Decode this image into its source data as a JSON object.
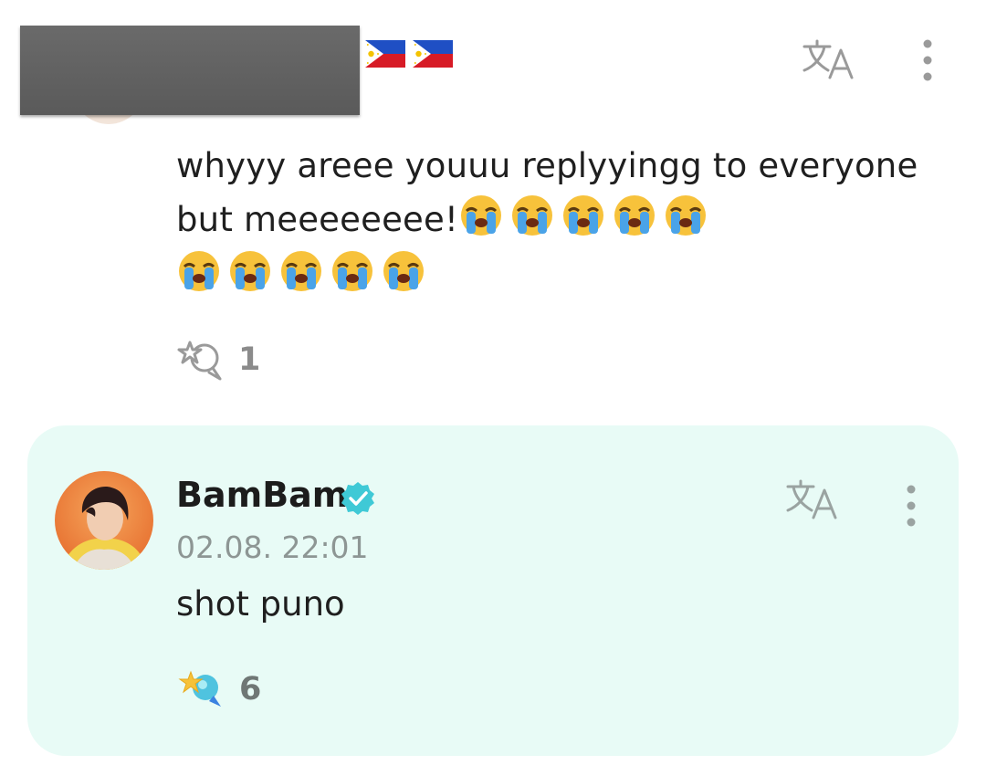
{
  "colors": {
    "reply_card_background": "#e8fbf6",
    "verified_badge": "#3fc9d6",
    "muted_text": "#8d9694",
    "icon_gray": "#9a9a9a"
  },
  "comment": {
    "flags": [
      "flag-philippines-icon",
      "flag-philippines-icon"
    ],
    "text": "whyyy areee youuu replyyingg to everyone but meeeeeeee!",
    "emoji_count_line1": 5,
    "emoji_count_line2": 5,
    "emoji": "loudly-crying-face-icon",
    "reply_icon": "reply-bubble-star-icon",
    "reply_count": "1"
  },
  "reply": {
    "author": "BamBam",
    "verified_icon": "verified-badge-icon",
    "timestamp": "02.08. 22:01",
    "text": "shot puno",
    "reply_icon": "reply-bubble-star-filled-icon",
    "reply_count": "6"
  },
  "icons": {
    "translate": "translate-icon",
    "more": "more-vertical-icon"
  }
}
